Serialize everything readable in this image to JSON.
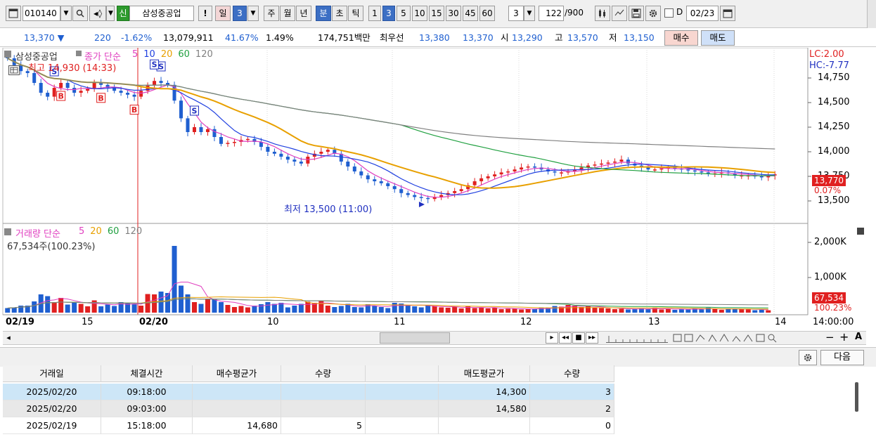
{
  "toolbar": {
    "code": "010140",
    "new_badge": "신",
    "stock_name": "삼성중공업",
    "exclaim": "!",
    "period_day": "일",
    "period_day_num": "3",
    "period_week": "주",
    "period_month": "월",
    "period_year": "년",
    "period_min": "분",
    "period_sec": "초",
    "period_tick": "틱",
    "minute_options": [
      "1",
      "3",
      "5",
      "10",
      "15",
      "30",
      "45",
      "60"
    ],
    "minute_selected": "3",
    "interval_value": "3",
    "count_value": "122",
    "count_total": "/900",
    "d_label": "D",
    "date_value": "02/23"
  },
  "quote": {
    "price": "13,370",
    "change": "220",
    "change_pct": "-1.62%",
    "volume": "13,079,911",
    "vol_ratio": "41.67%",
    "turnover": "1.49%",
    "amount": "174,751백만",
    "best_label": "최우선",
    "best_ask": "13,380",
    "best_bid": "13,370",
    "open_label": "시",
    "open": "13,290",
    "high_label": "고",
    "high": "13,570",
    "low_label": "저",
    "low": "13,150",
    "buy_label": "매수",
    "sell_label": "매도"
  },
  "chart": {
    "stock_label": "삼성중공업",
    "price_legend_prefix": "종가 단순",
    "ma_periods": [
      "5",
      "10",
      "20",
      "60",
      "120"
    ],
    "ma_colors": [
      "#e040c0",
      "#2040e0",
      "#e8a000",
      "#20a040",
      "#808080"
    ],
    "lc_label": "LC:2.00",
    "hc_label": "HC:-7.77",
    "high_annotation": "최고 14,930 (14:33)",
    "low_annotation": "최저 13,500 (11:00)",
    "current_price_tag": "13,770",
    "current_pct_tag": "0.07%",
    "volume_legend_label": "거래량 단순",
    "volume_ma_periods": [
      "5",
      "20",
      "60",
      "120"
    ],
    "volume_info": "67,534주(100.23%)",
    "volume_tag": "67,534",
    "volume_pct_tag": "100.23%",
    "x_labels": [
      "02/19",
      "15",
      "02/20",
      "10",
      "11",
      "12",
      "13",
      "14"
    ],
    "x_time_label": "14:00:00",
    "signals": [
      {
        "type": "S",
        "color": "#2030c0"
      },
      {
        "type": "S",
        "color": "#2030c0"
      },
      {
        "type": "B",
        "color": "#e02020"
      },
      {
        "type": "B",
        "color": "#e02020"
      },
      {
        "type": "B",
        "color": "#e02020"
      },
      {
        "type": "S",
        "color": "#2030c0"
      },
      {
        "type": "S",
        "color": "#2030c0"
      }
    ]
  },
  "chart_data": {
    "type": "candlestick",
    "price_axis_ticks": [
      "14,750",
      "14,500",
      "14,250",
      "14,000",
      "13,750",
      "13,500"
    ],
    "volume_axis_ticks": [
      "2,000K",
      "1,000K"
    ],
    "ylim": [
      13300,
      15000
    ],
    "volume_ylim": [
      0,
      2300000
    ],
    "up_color": "#e02020",
    "down_color": "#1f5fd0",
    "price_path": [
      14950,
      14880,
      14820,
      14800,
      14700,
      14600,
      14560,
      14650,
      14700,
      14650,
      14600,
      14620,
      14640,
      14700,
      14680,
      14650,
      14620,
      14600,
      14580,
      14560,
      14620,
      14680,
      14720,
      14700,
      14680,
      14520,
      14340,
      14200,
      14250,
      14200,
      14230,
      14150,
      14080,
      14090,
      14100,
      14120,
      14130,
      14100,
      14050,
      14000,
      13980,
      13950,
      13920,
      13900,
      13880,
      13950,
      13980,
      14000,
      14020,
      13980,
      13900,
      13850,
      13800,
      13760,
      13720,
      13700,
      13680,
      13650,
      13620,
      13580,
      13560,
      13540,
      13530,
      13520,
      13540,
      13560,
      13580,
      13600,
      13620,
      13660,
      13700,
      13730,
      13750,
      13770,
      13790,
      13800,
      13820,
      13840,
      13850,
      13840,
      13820,
      13800,
      13790,
      13790,
      13800,
      13820,
      13840,
      13860,
      13870,
      13880,
      13890,
      13900,
      13920,
      13880,
      13860,
      13840,
      13820,
      13820,
      13830,
      13840,
      13830,
      13820,
      13810,
      13800,
      13790,
      13780,
      13780,
      13790,
      13780,
      13760,
      13760,
      13760,
      13750,
      13740,
      13760,
      13770
    ],
    "volume_path": [
      130000,
      150000,
      200000,
      200000,
      320000,
      520000,
      470000,
      300000,
      420000,
      230000,
      300000,
      250000,
      180000,
      350000,
      180000,
      230000,
      190000,
      300000,
      270000,
      250000,
      200000,
      530000,
      520000,
      600000,
      560000,
      1900000,
      770000,
      520000,
      300000,
      250000,
      400000,
      380000,
      300000,
      220000,
      160000,
      190000,
      150000,
      200000,
      240000,
      300000,
      250000,
      280000,
      150000,
      200000,
      250000,
      310000,
      280000,
      330000,
      200000,
      160000,
      190000,
      250000,
      160000,
      150000,
      240000,
      190000,
      160000,
      130000,
      280000,
      260000,
      200000,
      180000,
      150000,
      220000,
      180000,
      150000,
      140000,
      160000,
      120000,
      180000,
      130000,
      150000,
      120000,
      140000,
      100000,
      110000,
      120000,
      90000,
      100000,
      110000,
      140000,
      130000,
      190000,
      170000,
      220000,
      200000,
      160000,
      180000,
      150000,
      130000,
      120000,
      100000,
      110000,
      90000,
      100000,
      120000,
      110000,
      130000,
      90000,
      100000,
      80000,
      110000,
      100000,
      120000,
      90000,
      140000,
      100000,
      80000,
      120000,
      110000,
      100000,
      90000,
      70000,
      80000,
      67534
    ]
  },
  "nav": {
    "scroll_left": "◂",
    "play_controls": [
      "▸",
      "◂◂",
      "■",
      "▸▸"
    ],
    "zoom_minus": "−",
    "zoom_plus": "+",
    "a_label": "A"
  },
  "grid": {
    "next_label": "다음",
    "headers": [
      "거래일",
      "체결시간",
      "매수평균가",
      "수량",
      "",
      "매도평균가",
      "수량"
    ],
    "rows": [
      [
        "2025/02/20",
        "09:18:00",
        "",
        "",
        "",
        "14,300",
        "3"
      ],
      [
        "2025/02/20",
        "09:03:00",
        "",
        "",
        "",
        "14,580",
        "2"
      ],
      [
        "2025/02/19",
        "15:18:00",
        "14,680",
        "5",
        "",
        "",
        "0"
      ]
    ]
  }
}
